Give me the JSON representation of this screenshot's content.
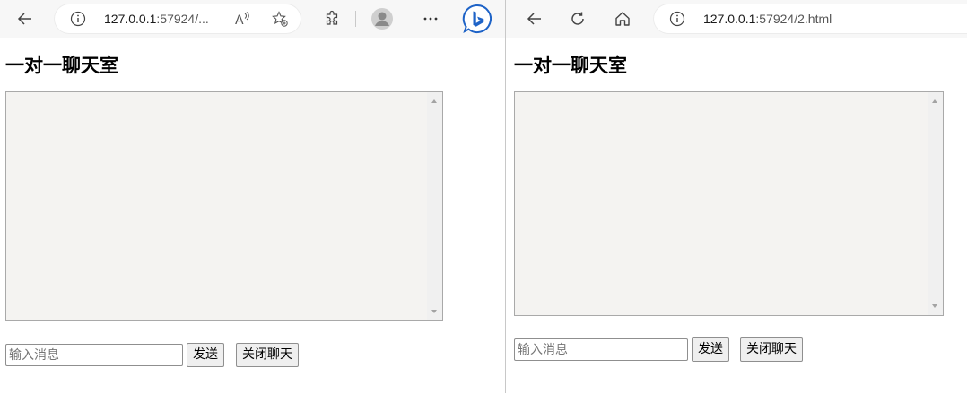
{
  "left_window": {
    "url_host": "127.0.0.1",
    "url_rest": ":57924/...",
    "page": {
      "title": "一对一聊天室",
      "input_placeholder": "输入消息",
      "send_label": "发送",
      "close_label": "关闭聊天"
    }
  },
  "right_window": {
    "url_host": "127.0.0.1",
    "url_rest": ":57924/2.html",
    "page": {
      "title": "一对一聊天室",
      "input_placeholder": "输入消息",
      "send_label": "发送",
      "close_label": "关闭聊天"
    }
  },
  "icons": {
    "back": "back-arrow-icon",
    "refresh": "refresh-icon",
    "home": "home-icon",
    "info": "site-info-icon",
    "read_aloud": "read-aloud-icon",
    "favorite": "add-favorite-icon",
    "extensions": "extensions-icon",
    "profile": "profile-icon",
    "more": "more-icon",
    "bing": "bing-chat-icon"
  },
  "colors": {
    "bing_accent": "#1e63c7",
    "chat_bg": "#f4f3f1"
  }
}
